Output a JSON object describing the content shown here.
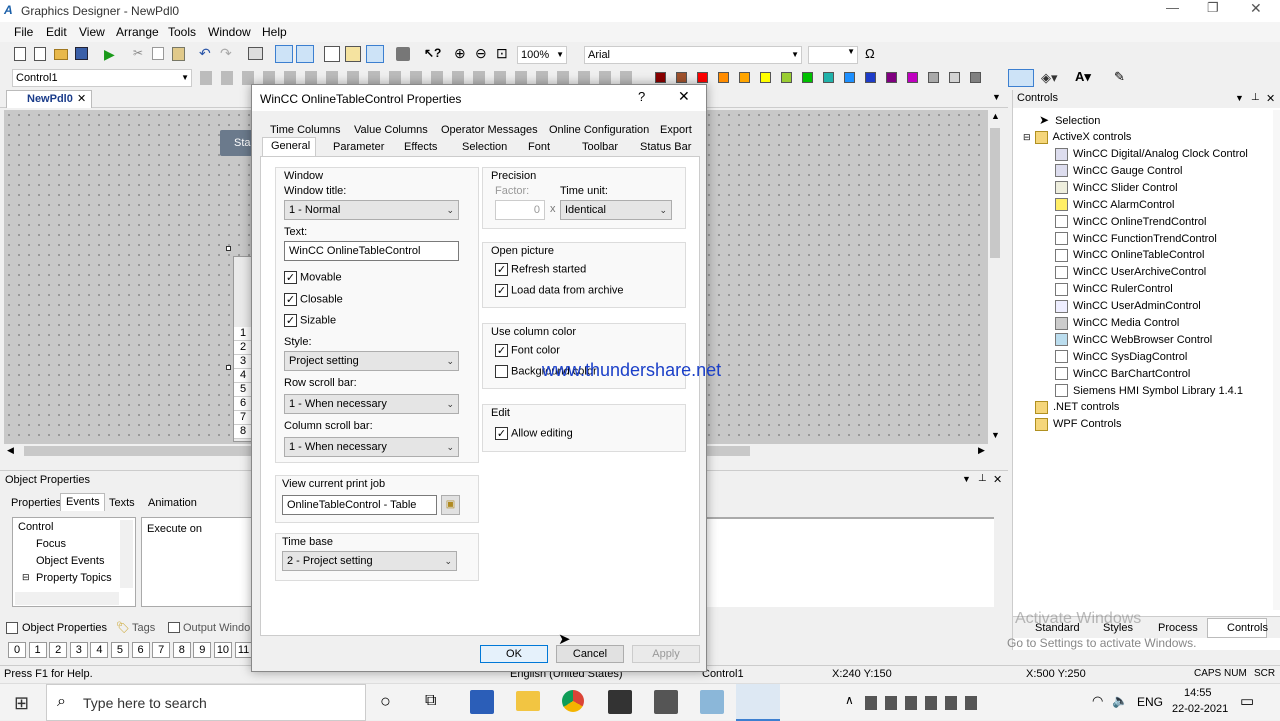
{
  "app": {
    "title": "Graphics Designer - NewPdl0",
    "menu": [
      "File",
      "Edit",
      "View",
      "Arrange",
      "Tools",
      "Window",
      "Help"
    ],
    "zoom": "100%",
    "font": "Arial",
    "control_select": "Control1",
    "doc_tab": "NewPdl0",
    "canvas_button": "Sta",
    "row_numbers": [
      "1",
      "2",
      "3",
      "4",
      "5",
      "6",
      "7",
      "8"
    ]
  },
  "palette": [
    "#8b0000",
    "#a0522d",
    "#ff0000",
    "#ff8c00",
    "#ffa500",
    "#ffff00",
    "#9acd32",
    "#00c000",
    "#20b2aa",
    "#1e90ff",
    "#1e3cc8",
    "#800080",
    "#c000c0",
    "#a9a9a9",
    "#d3d3d3",
    "#808080",
    "#000000",
    "#ffffff"
  ],
  "dialog": {
    "title": "WinCC OnlineTableControl Properties",
    "help": "?",
    "close": "✕",
    "tabs_row1": [
      "Time Columns",
      "Value Columns",
      "Operator Messages",
      "Online Configuration",
      "Export"
    ],
    "tabs_row2": [
      "General",
      "Parameter",
      "Effects",
      "Selection",
      "Font",
      "Toolbar",
      "Status Bar"
    ],
    "window_group": "Window",
    "window_title_label": "Window title:",
    "window_title_value": "1 - Normal",
    "text_label": "Text:",
    "text_value": "WinCC OnlineTableControl",
    "movable": "Movable",
    "closable": "Closable",
    "sizable": "Sizable",
    "style_label": "Style:",
    "style_value": "Project setting",
    "row_scroll_label": "Row scroll bar:",
    "row_scroll_value": "1 - When necessary",
    "col_scroll_label": "Column scroll bar:",
    "col_scroll_value": "1 - When necessary",
    "print_group": "View current print job",
    "print_value": "OnlineTableControl - Table",
    "timebase_group": "Time base",
    "timebase_value": "2 - Project setting",
    "precision_group": "Precision",
    "factor_label": "Factor:",
    "factor_value": "0",
    "factor_x": "x",
    "time_unit_label": "Time unit:",
    "time_unit_value": "Identical",
    "open_picture_group": "Open picture",
    "refresh_started": "Refresh started",
    "load_data": "Load data from archive",
    "use_column_group": "Use column color",
    "font_color": "Font color",
    "background_color": "Background color",
    "edit_group": "Edit",
    "allow_editing": "Allow editing",
    "ok": "OK",
    "cancel": "Cancel",
    "apply": "Apply"
  },
  "watermark": "www.thundershare.net",
  "object_properties": {
    "title": "Object Properties",
    "tabs": [
      "Properties",
      "Events",
      "Texts",
      "Animation"
    ],
    "tree": [
      "Control",
      "Focus",
      "Object Events",
      "Property Topics"
    ],
    "execute_on": "Execute on"
  },
  "bottom_tabs": [
    "Object Properties",
    "Tags",
    "Output Windo"
  ],
  "layers": [
    "0",
    "1",
    "2",
    "3",
    "4",
    "5",
    "6",
    "7",
    "8",
    "9",
    "10",
    "11"
  ],
  "controls": {
    "title": "Controls",
    "selection": "Selection",
    "activex": "ActiveX controls",
    "items": [
      "WinCC Digital/Analog Clock Control",
      "WinCC Gauge Control",
      "WinCC Slider Control",
      "WinCC AlarmControl",
      "WinCC OnlineTrendControl",
      "WinCC FunctionTrendControl",
      "WinCC OnlineTableControl",
      "WinCC UserArchiveControl",
      "WinCC RulerControl",
      "WinCC UserAdminControl",
      "WinCC Media Control",
      "WinCC WebBrowser Control",
      "WinCC SysDiagControl",
      "WinCC BarChartControl",
      "Siemens HMI Symbol Library 1.4.1"
    ],
    "net": ".NET controls",
    "wpf": "WPF Controls",
    "bottom_tabs": [
      "Standard",
      "Styles",
      "Process",
      "Controls"
    ],
    "activate_line1": "Activate Windows",
    "activate_line2": "Go to Settings to activate Windows."
  },
  "status": {
    "help": "Press F1 for Help.",
    "lang": "English (United States)",
    "obj": "Control1",
    "pos": "X:240 Y:150",
    "size": "X:500 Y:250",
    "caps": "CAPS",
    "num": "NUM",
    "scr": "SCR"
  },
  "taskbar": {
    "search": "Type here to search",
    "lang": "ENG",
    "time": "14:55",
    "date": "22-02-2021"
  }
}
